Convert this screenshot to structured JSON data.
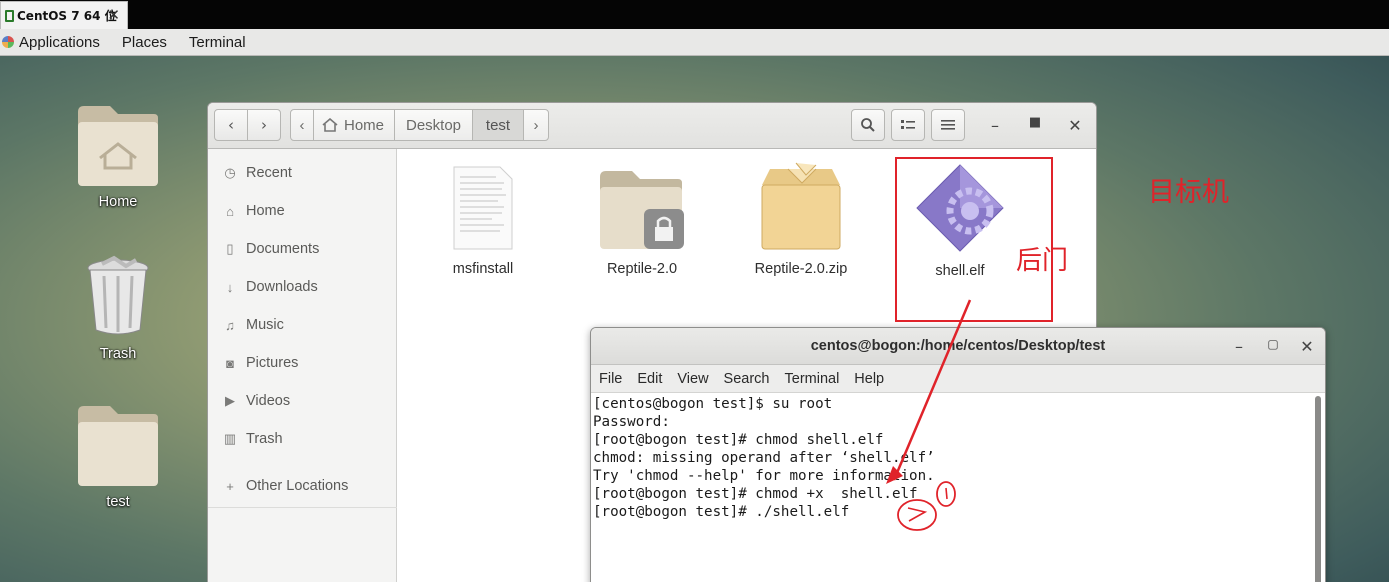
{
  "vm": {
    "tab_label": "CentOS 7 64 位"
  },
  "top_panel": {
    "items": [
      "Applications",
      "Places",
      "Terminal"
    ]
  },
  "desktop_icons": [
    {
      "label": "Home",
      "icon": "home-folder-icon"
    },
    {
      "label": "Trash",
      "icon": "trash-icon"
    },
    {
      "label": "test",
      "icon": "folder-icon"
    }
  ],
  "file_manager": {
    "breadcrumb": [
      "Home",
      "Desktop",
      "test"
    ],
    "sidebar": [
      {
        "label": "Recent",
        "icon": "clock-icon"
      },
      {
        "label": "Home",
        "icon": "home-icon"
      },
      {
        "label": "Documents",
        "icon": "document-icon"
      },
      {
        "label": "Downloads",
        "icon": "download-icon"
      },
      {
        "label": "Music",
        "icon": "music-icon"
      },
      {
        "label": "Pictures",
        "icon": "camera-icon"
      },
      {
        "label": "Videos",
        "icon": "video-icon"
      },
      {
        "label": "Trash",
        "icon": "trash-icon"
      },
      {
        "label": "Other Locations",
        "icon": "plus-icon"
      }
    ],
    "files": [
      {
        "name": "msfinstall",
        "icon": "text-document-icon"
      },
      {
        "name": "Reptile-2.0",
        "icon": "locked-folder-icon"
      },
      {
        "name": "Reptile-2.0.zip",
        "icon": "archive-box-icon"
      },
      {
        "name": "shell.elf",
        "icon": "executable-gear-icon"
      }
    ]
  },
  "terminal": {
    "title": "centos@bogon:/home/centos/Desktop/test",
    "menu": [
      "File",
      "Edit",
      "View",
      "Search",
      "Terminal",
      "Help"
    ],
    "lines": [
      "[centos@bogon test]$ su root",
      "Password:",
      "[root@bogon test]# chmod shell.elf",
      "chmod: missing operand after ‘shell.elf’",
      "Try 'chmod --help' for more information.",
      "[root@bogon test]# chmod +x  shell.elf",
      "[root@bogon test]# ./shell.elf"
    ]
  },
  "annotations": {
    "target_label": "目标机",
    "backdoor_label": "后门",
    "color": "#e0232a"
  }
}
